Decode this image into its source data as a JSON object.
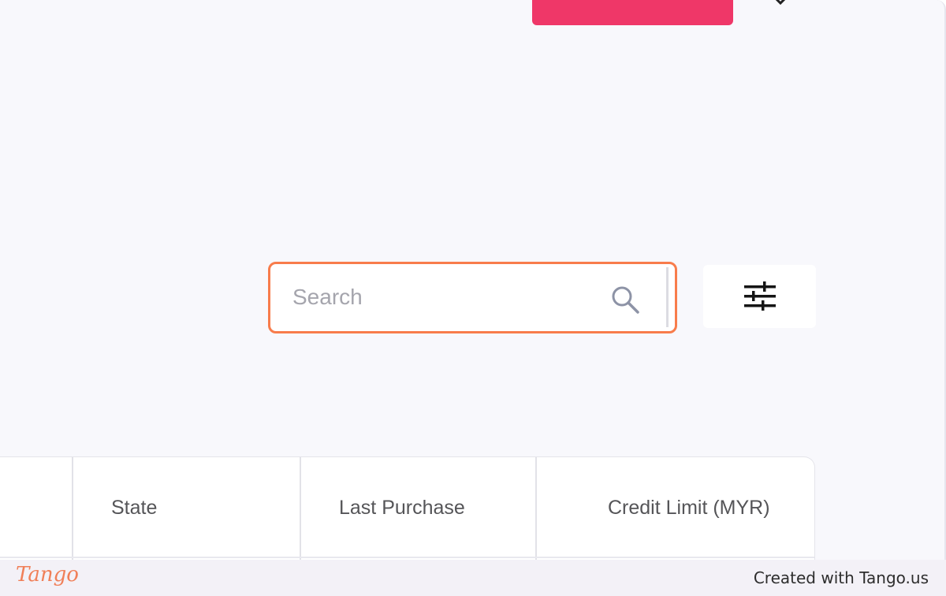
{
  "search": {
    "placeholder": "Search"
  },
  "icons": {
    "search": "search-icon",
    "filter": "sliders-icon"
  },
  "table": {
    "columns": [
      "",
      "State",
      "Last Purchase",
      "Credit Limit (MYR)"
    ]
  },
  "footer": {
    "logo": "Tango",
    "credit": "Created with Tango.us"
  },
  "colors": {
    "highlight": "#f87c4b",
    "primary_button": "#ef3768",
    "background": "#f8f8fc",
    "brand": "#f07f58"
  }
}
